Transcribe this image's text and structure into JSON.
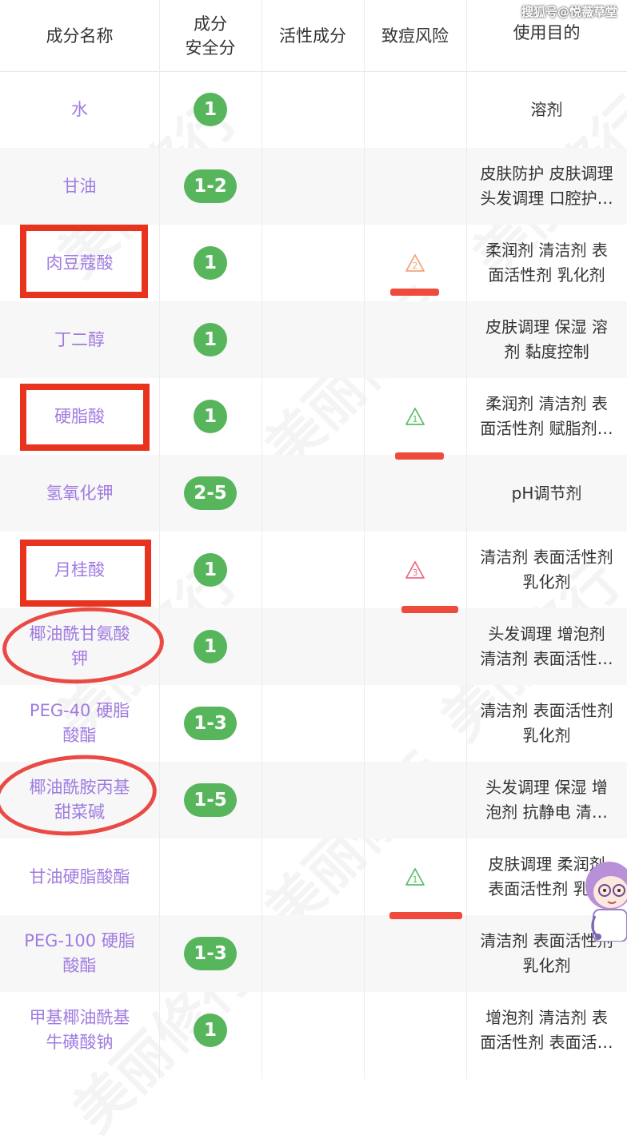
{
  "source_watermark": "搜狐号@悦薇草堂",
  "background_watermark": "美丽修行",
  "headers": {
    "name": "成分名称",
    "safety": "成分\n安全分",
    "active": "活性成分",
    "acne_risk": "致痘风险",
    "purpose": "使用目的"
  },
  "rows": [
    {
      "name": "水",
      "safety": "1",
      "acne_risk": "",
      "purpose": "溶剂"
    },
    {
      "name": "甘油",
      "safety": "1-2",
      "acne_risk": "",
      "purpose": "皮肤防护 皮肤调理\n头发调理 口腔护…"
    },
    {
      "name": "肉豆蔻酸",
      "safety": "1",
      "acne_risk": "2",
      "purpose": "柔润剂 清洁剂 表\n面活性剂 乳化剂"
    },
    {
      "name": "丁二醇",
      "safety": "1",
      "acne_risk": "",
      "purpose": "皮肤调理 保湿 溶\n剂 黏度控制"
    },
    {
      "name": "硬脂酸",
      "safety": "1",
      "acne_risk": "1",
      "purpose": "柔润剂 清洁剂 表\n面活性剂 赋脂剂…"
    },
    {
      "name": "氢氧化钾",
      "safety": "2-5",
      "acne_risk": "",
      "purpose": "pH调节剂"
    },
    {
      "name": "月桂酸",
      "safety": "1",
      "acne_risk": "3",
      "purpose": "清洁剂 表面活性剂\n乳化剂"
    },
    {
      "name": "椰油酰甘氨酸\n钾",
      "safety": "1",
      "acne_risk": "",
      "purpose": "头发调理 增泡剂\n清洁剂 表面活性…"
    },
    {
      "name": "PEG-40 硬脂\n酸酯",
      "safety": "1-3",
      "acne_risk": "",
      "purpose": "清洁剂 表面活性剂\n乳化剂"
    },
    {
      "name": "椰油酰胺丙基\n甜菜碱",
      "safety": "1-5",
      "acne_risk": "",
      "purpose": "头发调理 保湿 增\n泡剂 抗静电 清…"
    },
    {
      "name": "甘油硬脂酸酯",
      "safety": "",
      "acne_risk": "1",
      "purpose": "皮肤调理 柔润剂\n表面活性剂 乳…"
    },
    {
      "name": "PEG-100 硬脂\n酸酯",
      "safety": "1-3",
      "acne_risk": "",
      "purpose": "清洁剂 表面活性剂\n乳化剂"
    },
    {
      "name": "甲基椰油酰基\n牛磺酸钠",
      "safety": "1",
      "acne_risk": "",
      "purpose": "增泡剂 清洁剂 表\n面活性剂 表面活…"
    }
  ],
  "colors": {
    "name_text": "#a07be0",
    "safety_pill": "#57b65c",
    "risk_1": "#5cc06a",
    "risk_2": "#f2a37a",
    "risk_3": "#ee6b86",
    "annotation_red": "#e8331f"
  }
}
